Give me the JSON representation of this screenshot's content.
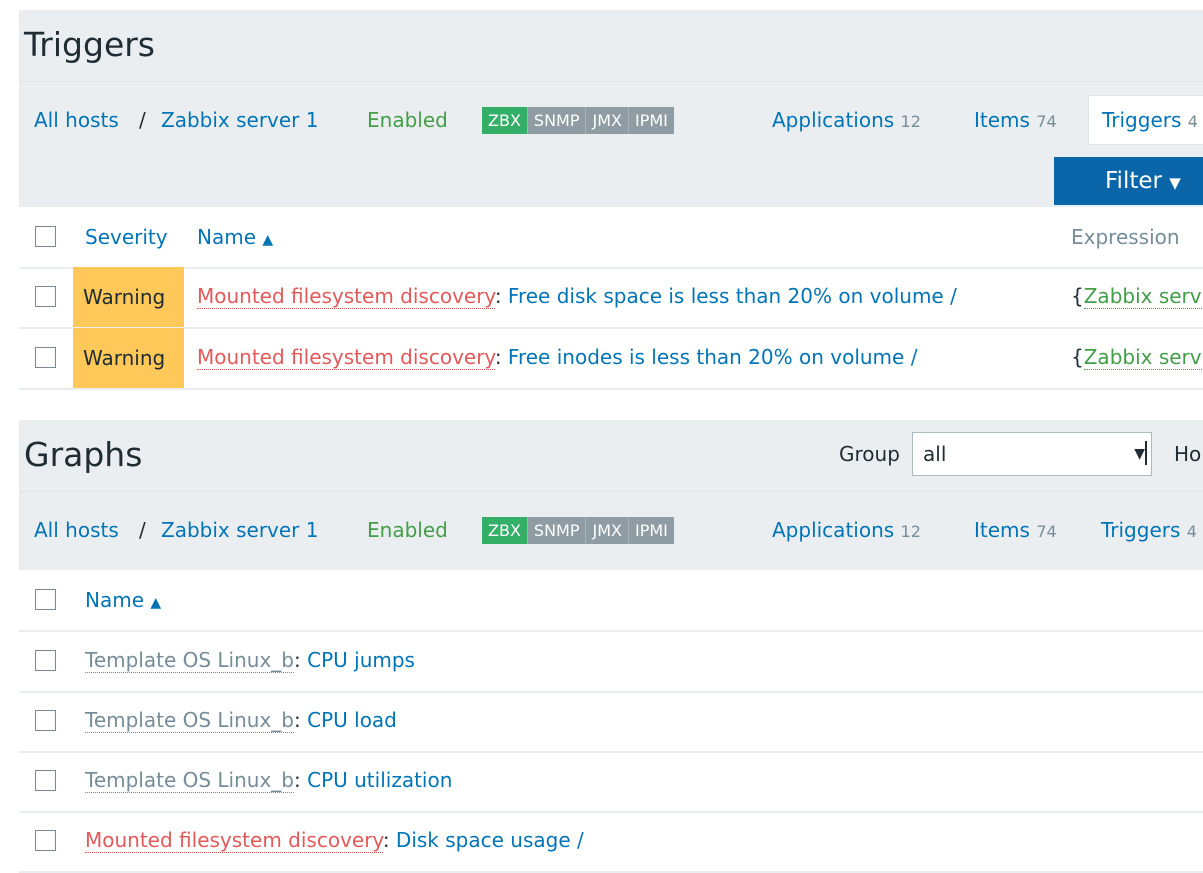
{
  "triggers": {
    "title": "Triggers",
    "nav": {
      "all_hosts": "All hosts",
      "slash": "/",
      "host": "Zabbix server 1",
      "status": "Enabled",
      "tags": [
        "ZBX",
        "SNMP",
        "JMX",
        "IPMI"
      ],
      "applications_label": "Applications",
      "applications_count": "12",
      "items_label": "Items",
      "items_count": "74",
      "triggers_label": "Triggers",
      "triggers_count": "4"
    },
    "filter_label": "Filter",
    "filter_icon": "caret-down-icon",
    "columns": {
      "severity": "Severity",
      "name": "Name",
      "sort_icon": "▲",
      "expression": "Expression"
    },
    "rows": [
      {
        "severity": "Warning",
        "prefix": "Mounted filesystem discovery",
        "colon": ":",
        "name": "Free disk space is less than 20% on volume /",
        "expr_brace": "{",
        "expr": "Zabbix serv"
      },
      {
        "severity": "Warning",
        "prefix": "Mounted filesystem discovery",
        "colon": ":",
        "name": "Free inodes is less than 20% on volume /",
        "expr_brace": "{",
        "expr": "Zabbix serv"
      }
    ],
    "severity_color": "#ffc859"
  },
  "graphs": {
    "title": "Graphs",
    "group_label": "Group",
    "group_value": "all",
    "host_label_partial": "Ho",
    "nav": {
      "all_hosts": "All hosts",
      "slash": "/",
      "host": "Zabbix server 1",
      "status": "Enabled",
      "tags": [
        "ZBX",
        "SNMP",
        "JMX",
        "IPMI"
      ],
      "applications_label": "Applications",
      "applications_count": "12",
      "items_label": "Items",
      "items_count": "74",
      "triggers_label": "Triggers",
      "triggers_count": "4"
    },
    "columns": {
      "name": "Name",
      "sort_icon": "▲"
    },
    "rows": [
      {
        "prefix": "Template OS Linux_b",
        "colon": ":",
        "name": "CPU jumps"
      },
      {
        "prefix": "Template OS Linux_b",
        "colon": ":",
        "name": "CPU load"
      },
      {
        "prefix": "Template OS Linux_b",
        "colon": ":",
        "name": "CPU utilization"
      },
      {
        "prefix": "Mounted filesystem discovery",
        "colon": ":",
        "name": "Disk space usage /"
      }
    ]
  },
  "colors": {
    "link": "#0275b8",
    "enabled": "#429e47",
    "zbx_tag": "#34af67",
    "disabled_tag": "#8f9ca3",
    "discovery_prefix": "#e45959",
    "filter_button": "#0a66a8"
  }
}
